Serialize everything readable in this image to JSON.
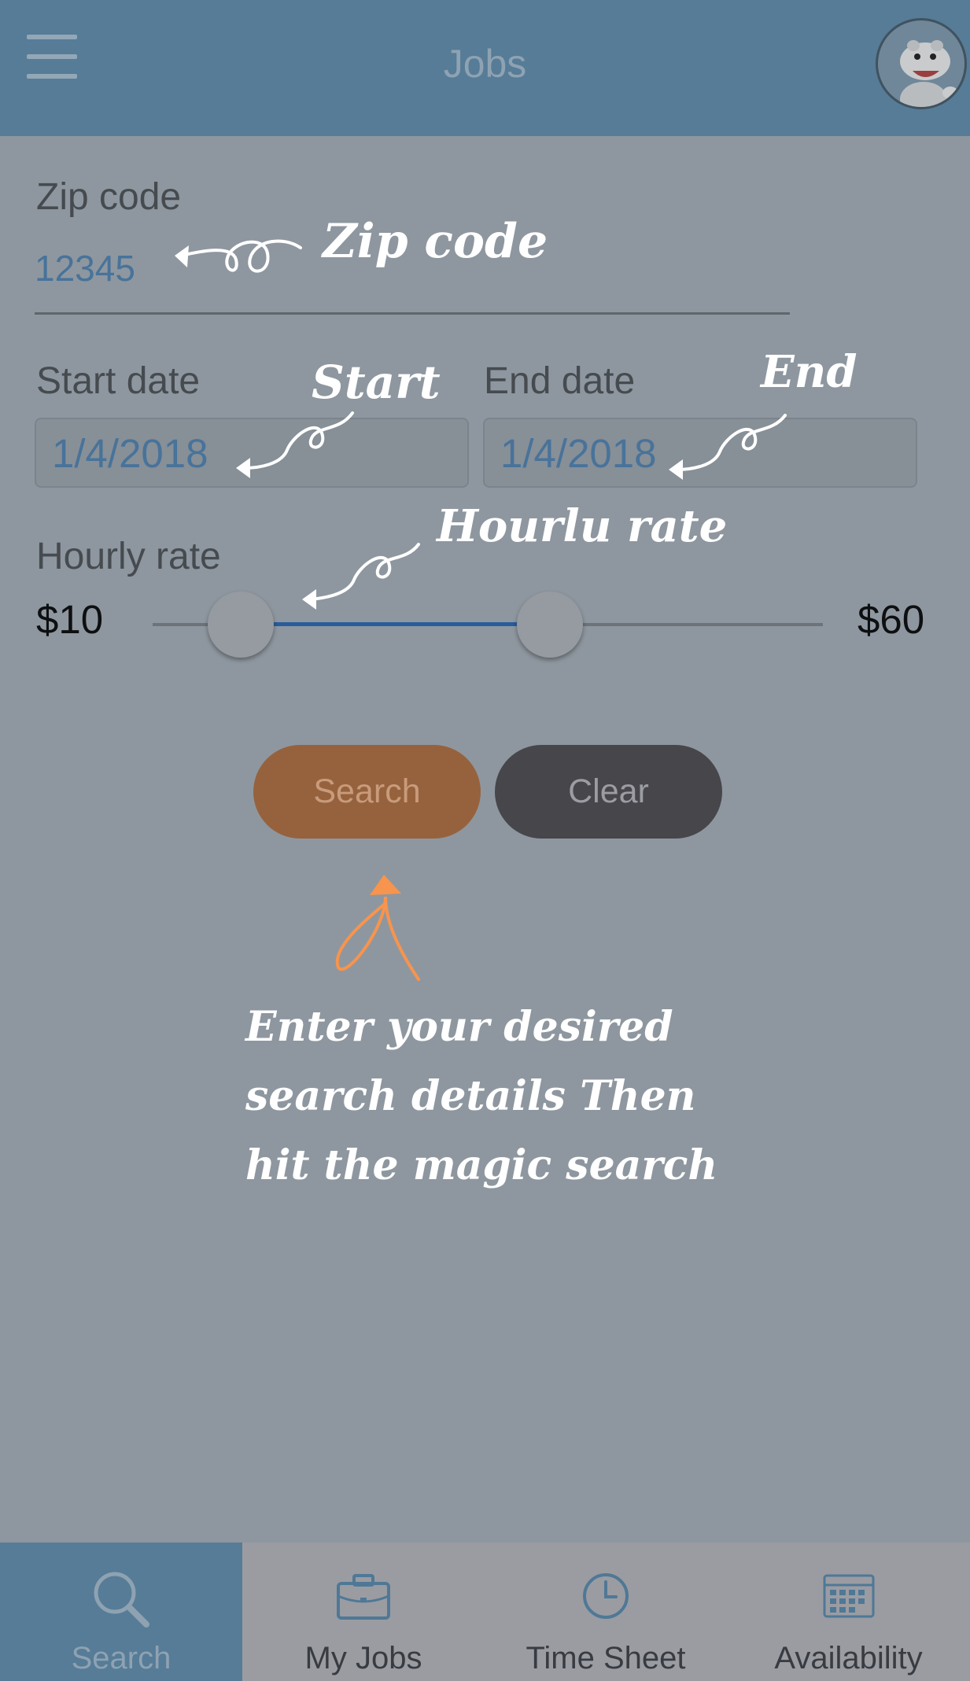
{
  "header": {
    "title": "Jobs"
  },
  "form": {
    "zip_label": "Zip code",
    "zip_value": "12345",
    "start_label": "Start date",
    "start_value": "1/4/2018",
    "end_label": "End date",
    "end_value": "1/4/2018",
    "rate_label": "Hourly rate",
    "rate_min": "$10",
    "rate_max": "$60"
  },
  "buttons": {
    "search": "Search",
    "clear": "Clear"
  },
  "annotations": {
    "zip": "Zip code",
    "start": "Start",
    "end": "End",
    "rate": "Hourlu rate",
    "instruction_lines": [
      "Enter your desired",
      "search details Then",
      "hit the magic search"
    ]
  },
  "tabs": [
    {
      "label": "Search",
      "icon": "search-icon",
      "active": true
    },
    {
      "label": "My Jobs",
      "icon": "briefcase-icon",
      "active": false
    },
    {
      "label": "Time Sheet",
      "icon": "clock-icon",
      "active": false
    },
    {
      "label": "Availability",
      "icon": "calendar-icon",
      "active": false
    }
  ],
  "colors": {
    "header": "#567c97",
    "search_button": "#96623d",
    "clear_button": "#46464b",
    "arrow_accent": "#f7944d"
  }
}
